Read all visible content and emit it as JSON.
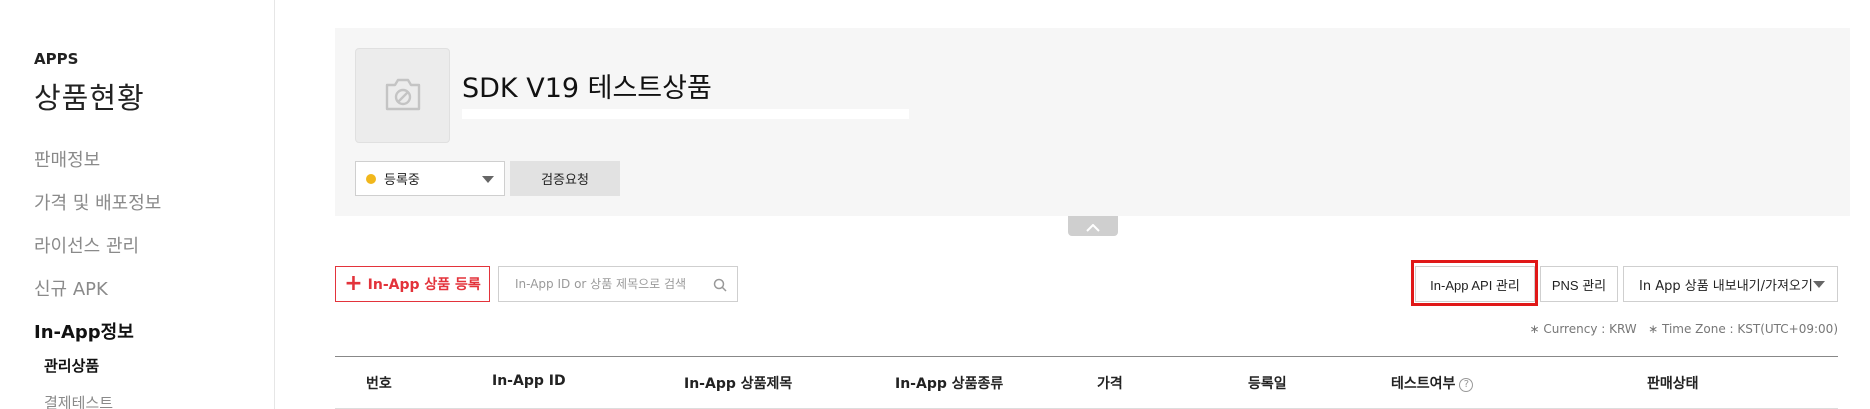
{
  "sidebar": {
    "section": "APPS",
    "title": "상품현황",
    "items": [
      {
        "label": "판매정보"
      },
      {
        "label": "가격 및 배포정보"
      },
      {
        "label": "라이선스 관리"
      },
      {
        "label": "신규 APK"
      },
      {
        "label": "In-App정보"
      }
    ],
    "subitems": [
      {
        "label": "관리상품"
      },
      {
        "label": "결제테스트"
      }
    ]
  },
  "product": {
    "title": "SDK V19 테스트상품",
    "status": "등록중",
    "verify_label": "검증요청",
    "status_color": "#f1b71c"
  },
  "toolbar": {
    "register_label": "In-App 상품 등록",
    "search_placeholder": "In-App ID or 상품 제목으로 검색",
    "api_label": "In-App API 관리",
    "pns_label": "PNS 관리",
    "export_label": "In App 상품 내보내기/가져오기"
  },
  "meta": {
    "line": "∗ Currency : KRW   ∗ Time Zone : KST(UTC+09:00)"
  },
  "table": {
    "headers": [
      "번호",
      "In-App ID",
      "In-App 상품제목",
      "In-App 상품종류",
      "가격",
      "등록일",
      "테스트여부",
      "판매상태"
    ]
  },
  "colors": {
    "accent": "#e3333b",
    "highlight": "#e01818"
  }
}
